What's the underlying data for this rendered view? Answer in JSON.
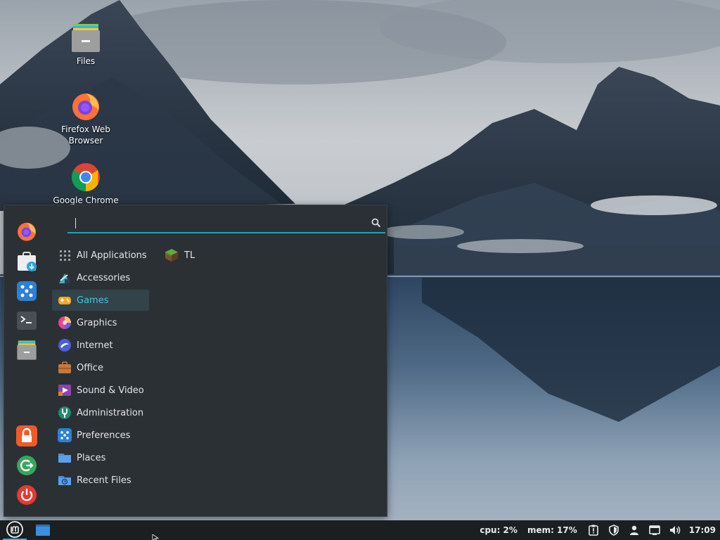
{
  "desktop": {
    "icons": [
      {
        "label": "Files",
        "icon": "folder-icon"
      },
      {
        "label": "Firefox Web Browser",
        "icon": "firefox-icon"
      },
      {
        "label": "Google Chrome",
        "icon": "chrome-icon"
      }
    ]
  },
  "menu": {
    "search": {
      "value": "",
      "placeholder": ""
    },
    "favorites": [
      {
        "name": "firefox",
        "icon": "firefox-icon"
      },
      {
        "name": "software-manager",
        "icon": "software-manager-icon"
      },
      {
        "name": "settings",
        "icon": "settings-icon"
      },
      {
        "name": "terminal",
        "icon": "terminal-icon"
      },
      {
        "name": "files",
        "icon": "folder-icon"
      }
    ],
    "session": [
      {
        "name": "lock-screen",
        "icon": "lock-icon"
      },
      {
        "name": "logout",
        "icon": "logout-icon"
      },
      {
        "name": "shutdown",
        "icon": "power-icon"
      }
    ],
    "categories": [
      {
        "label": "All Applications",
        "icon": "grid-icon"
      },
      {
        "label": "Accessories",
        "icon": "accessories-icon"
      },
      {
        "label": "Games",
        "icon": "gamepad-icon",
        "selected": true
      },
      {
        "label": "Graphics",
        "icon": "graphics-icon"
      },
      {
        "label": "Internet",
        "icon": "internet-icon"
      },
      {
        "label": "Office",
        "icon": "briefcase-icon"
      },
      {
        "label": "Sound & Video",
        "icon": "media-icon"
      },
      {
        "label": "Administration",
        "icon": "admin-icon"
      },
      {
        "label": "Preferences",
        "icon": "preferences-icon"
      },
      {
        "label": "Places",
        "icon": "folder-icon"
      },
      {
        "label": "Recent Files",
        "icon": "recent-icon"
      }
    ],
    "apps": [
      {
        "label": "TL",
        "icon": "grass-block-icon"
      }
    ]
  },
  "panel": {
    "cpu": "cpu: 2%",
    "mem": "mem: 17%",
    "clock": "17:09"
  },
  "colors": {
    "accent": "#24a1b9",
    "menu_bg": "#2b3035",
    "panel_bg": "#1c1f22",
    "selection_bg": "#324349"
  }
}
